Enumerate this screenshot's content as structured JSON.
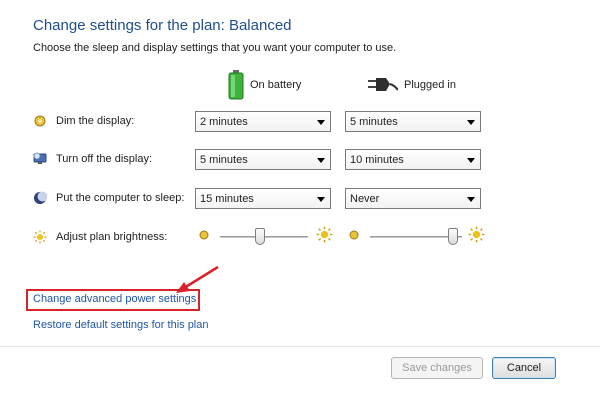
{
  "header": {
    "title": "Change settings for the plan: Balanced",
    "subtitle": "Choose the sleep and display settings that you want your computer to use."
  },
  "columns": {
    "battery_label": "On battery",
    "plugged_label": "Plugged in"
  },
  "rows": {
    "dim": {
      "label": "Dim the display:",
      "battery": "2 minutes",
      "plugged": "5 minutes"
    },
    "off": {
      "label": "Turn off the display:",
      "battery": "5 minutes",
      "plugged": "10 minutes"
    },
    "sleep": {
      "label": "Put the computer to sleep:",
      "battery": "15 minutes",
      "plugged": "Never"
    },
    "brightness": {
      "label": "Adjust plan brightness:",
      "battery_level": 0.45,
      "plugged_level": 0.95
    }
  },
  "links": {
    "advanced": "Change advanced power settings",
    "restore": "Restore default settings for this plan"
  },
  "buttons": {
    "save": "Save changes",
    "cancel": "Cancel"
  },
  "colors": {
    "title": "#1e4f8c",
    "link": "#1e56a8",
    "annotation": "#d9222a",
    "battery_green": "#3cb43c"
  }
}
